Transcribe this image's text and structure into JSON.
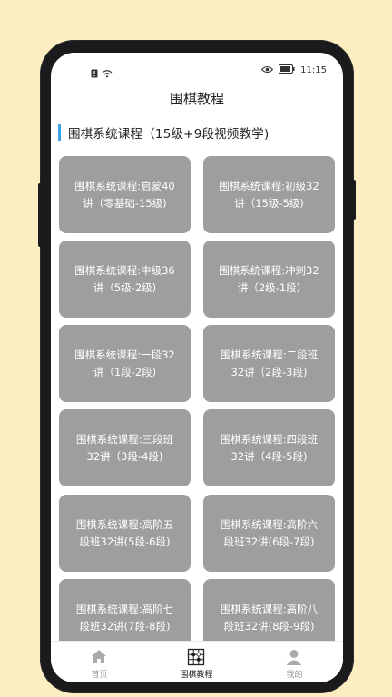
{
  "status": {
    "time": "11:15"
  },
  "nav": {
    "title": "围棋教程"
  },
  "section": {
    "title": "围棋系统课程（15级+9段视频教学)"
  },
  "courses": [
    "围棋系统课程:启蒙40讲（零基础-15级)",
    "围棋系统课程:初级32讲（15级-5级)",
    "围棋系统课程:中级36讲（5级-2级)",
    "围棋系统课程:冲刺32讲（2级-1段)",
    "围棋系统课程:一段32讲（1段-2段)",
    "围棋系统课程:二段班32讲（2段-3段)",
    "围棋系统课程:三段班32讲（3段-4段)",
    "围棋系统课程:四段班32讲（4段-5段)",
    "围棋系统课程:高阶五段班32讲(5段-6段)",
    "围棋系统课程:高阶六段班32讲(6段-7段)",
    "围棋系统课程:高阶七段班32讲(7段-8段)",
    "围棋系统课程:高阶八段班32讲(8段-9段)"
  ],
  "tabs": [
    {
      "label": "首页",
      "icon": "home-icon"
    },
    {
      "label": "围棋教程",
      "icon": "go-board-icon"
    },
    {
      "label": "我的",
      "icon": "user-icon"
    }
  ],
  "colors": {
    "background": "#fdeec2",
    "card": "#9e9e9e",
    "accent": "#3aa2e6"
  }
}
